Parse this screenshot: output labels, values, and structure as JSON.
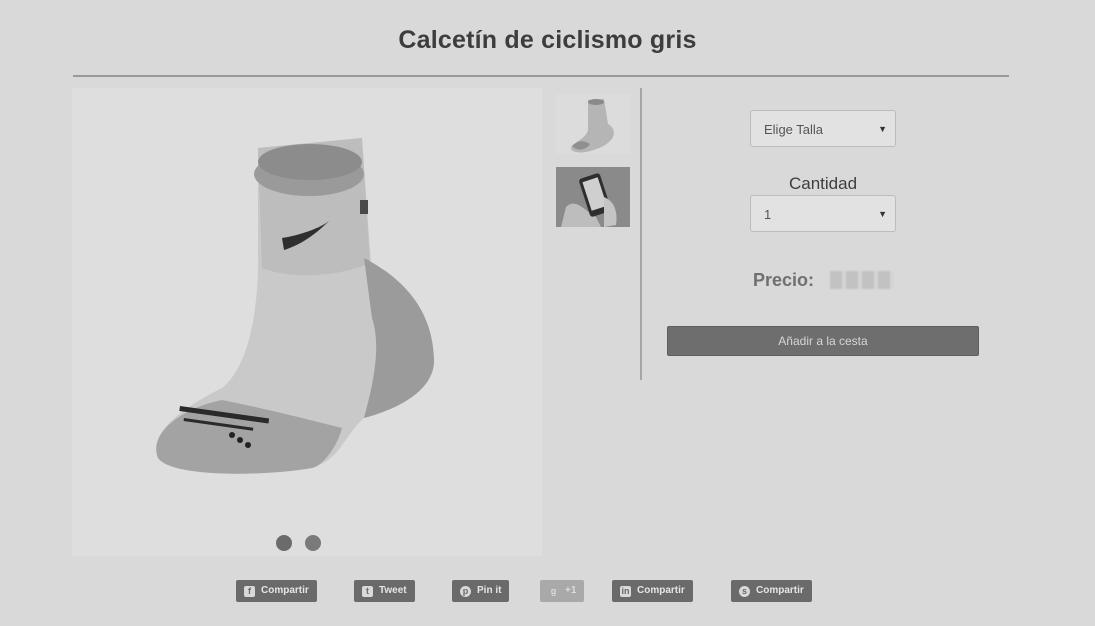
{
  "product": {
    "title": "Calcetín de ciclismo gris"
  },
  "options": {
    "size_selected": "Elige Talla",
    "quantity_label": "Cantidad",
    "quantity_selected": "1",
    "price_label": "Precio:",
    "add_to_cart": "Añadir a la cesta"
  },
  "carousel": {
    "slide_count": 2,
    "active_index": 0
  },
  "thumbnails": [
    {
      "icon": "sock-thumbnail"
    },
    {
      "icon": "phone-in-hand-thumbnail"
    }
  ],
  "share": [
    {
      "label": "Compartir",
      "icon": "facebook-icon",
      "glyph": "f"
    },
    {
      "label": "Tweet",
      "icon": "twitter-icon",
      "glyph": "t"
    },
    {
      "label": "Pin it",
      "icon": "pinterest-icon",
      "glyph": "p"
    },
    {
      "label": "+1",
      "icon": "google-plus-icon",
      "glyph": "g"
    },
    {
      "label": "Compartir",
      "icon": "linkedin-icon",
      "glyph": "in"
    },
    {
      "label": "Compartir",
      "icon": "skype-icon",
      "glyph": "s"
    }
  ]
}
